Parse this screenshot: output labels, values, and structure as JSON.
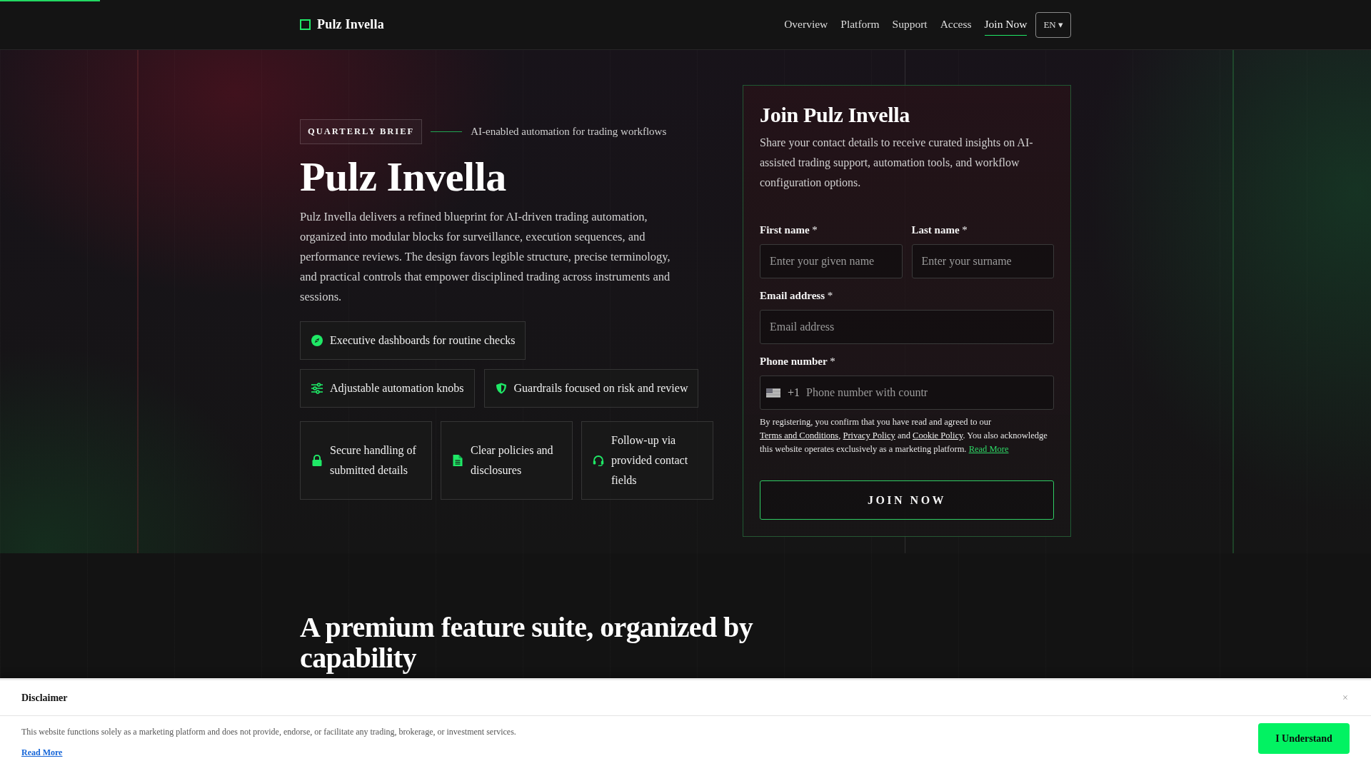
{
  "header": {
    "logo": "Pulz Invella",
    "nav": [
      {
        "label": "Overview",
        "selected": false
      },
      {
        "label": "Platform",
        "selected": false
      },
      {
        "label": "Support",
        "selected": false
      },
      {
        "label": "Access",
        "selected": false
      },
      {
        "label": "Join Now",
        "selected": true
      }
    ],
    "language": "EN ▾"
  },
  "hero": {
    "badge": "QUARTERLY BRIEF",
    "tagline": "AI-enabled automation for trading workflows",
    "title": "Pulz Invella",
    "description": "Pulz Invella delivers a refined blueprint for AI-driven trading automation, organized into modular blocks for surveillance, execution sequences, and performance reviews. The design favors legible structure, precise terminology, and practical controls that empower disciplined trading across instruments and sessions.",
    "feature_rows": [
      [
        {
          "kind": "chip",
          "text": "Executive dashboards for routine checks"
        }
      ],
      [
        {
          "kind": "chip",
          "text": "Adjustable automation knobs"
        },
        {
          "kind": "chip",
          "text": "Guardrails focused on risk and review"
        }
      ],
      [
        {
          "kind": "tile",
          "text": "Secure handling of submitted details"
        },
        {
          "kind": "tile",
          "text": "Clear policies and disclosures"
        },
        {
          "kind": "tile",
          "text": "Follow-up via provided contact fields"
        }
      ]
    ]
  },
  "signup_form": {
    "title": "Join Pulz Invella",
    "description": "Share your contact details to receive curated insights on AI-assisted trading support, automation tools, and workflow configuration options.",
    "field_rows": [
      [
        {
          "kind": "text",
          "label": "**First name** *",
          "placeholder": "Enter your given name"
        },
        {
          "kind": "text",
          "label": "**Last name** *",
          "placeholder": "Enter your surname"
        }
      ],
      [
        {
          "kind": "email",
          "label": "**Email address** *",
          "placeholder": "Email address"
        }
      ],
      [
        {
          "kind": "phone",
          "label": "**Phone number** *",
          "dial_code": "+1",
          "placeholder": "Phone number with countr"
        }
      ]
    ],
    "consent": [
      {
        "kind": "text",
        "text": "By registering, you confirm that you have read and agreed to our "
      },
      {
        "kind": "link",
        "text": "Terms and Conditions"
      },
      {
        "kind": "text",
        "text": ", "
      },
      {
        "kind": "link",
        "text": "Privacy Policy"
      },
      {
        "kind": "text",
        "text": " and "
      },
      {
        "kind": "link",
        "text": "Cookie Policy"
      },
      {
        "kind": "text",
        "text": ". You also acknowledge this website operates exclusively as a marketing platform. "
      },
      {
        "kind": "accent_link",
        "text": "Read More"
      }
    ],
    "submit": "JOIN NOW"
  },
  "features_section": {
    "heading": "A premium feature suite, organized by capability"
  },
  "disclaimer": {
    "title": "Disclaimer",
    "close": "×",
    "text": "This website functions solely as a marketing platform and does not provide, endorse, or facilitate any trading, brokerage, or investment services.",
    "link": "Read More",
    "button": "I Understand"
  }
}
